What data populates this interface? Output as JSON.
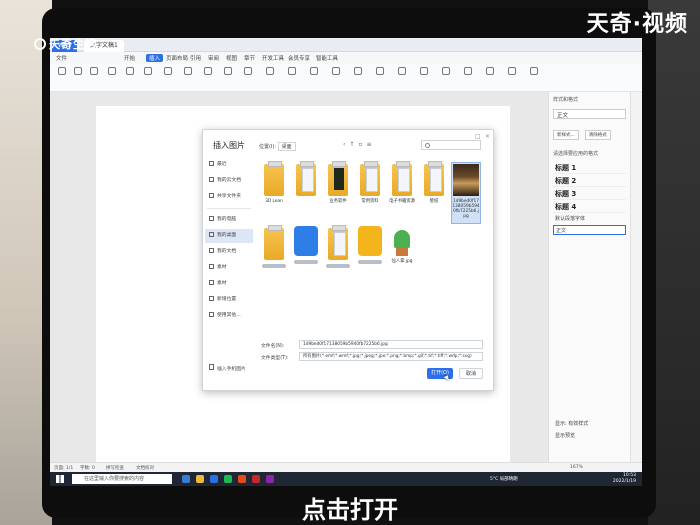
{
  "watermark": {
    "left": "天奇生活",
    "right": "天奇·视频"
  },
  "subtitle": "点击打开",
  "window": {
    "tabs": [
      "WPS",
      "文字文稿1"
    ],
    "menu": [
      "文件",
      "开始",
      "插入",
      "页面布局",
      "引用",
      "审阅",
      "视图",
      "章节",
      "开发工具",
      "会员专享",
      "智能工具"
    ],
    "active_menu": "插入"
  },
  "right_panel": {
    "title": "样式和格式",
    "current_style": "正文",
    "btn_new": "新样式...",
    "btn_clear": "清除格式",
    "hint": "请选择要应用的格式",
    "styles": [
      "标题 1",
      "标题 2",
      "标题 3",
      "标题 4"
    ],
    "small_items": [
      "默认段落字体",
      "正文"
    ],
    "footer_show": "显示: 有效样式",
    "footer_preview": "显示预览"
  },
  "dialog": {
    "title": "插入图片",
    "location_label": "位置(I):",
    "location_value": "桌面",
    "sidebar": [
      "最近",
      "我的云文档",
      "共享文件夹",
      "我的电脑",
      "我的桌面",
      "我的文档",
      "素材",
      "素材",
      "新增位置",
      "使用其他..."
    ],
    "sidebar_bottom": "插入手机图片",
    "files_row1": [
      {
        "name": "3D Lean",
        "kind": "folder"
      },
      {
        "name": "",
        "kind": "folder-doc"
      },
      {
        "name": "业务软件",
        "kind": "folder-dark"
      },
      {
        "name": "常用资料",
        "kind": "folder-doc"
      },
      {
        "name": "电子书籍资源",
        "kind": "folder-doc"
      },
      {
        "name": "壁纸",
        "kind": "folder-doc"
      },
      {
        "name": "1d9bed0f17138059b5940fb7225b6.jpg",
        "kind": "photo"
      }
    ],
    "files_row2": [
      {
        "name": "",
        "kind": "folder"
      },
      {
        "name": "",
        "kind": "app-blue"
      },
      {
        "name": "",
        "kind": "folder-doc"
      },
      {
        "name": "",
        "kind": "app-yellow"
      },
      {
        "name": "仙人掌.jpg",
        "kind": "cactus"
      }
    ],
    "filename_label": "文件名(N):",
    "filename_value": "1d9bed0f17138059b5940fb7225b6.jpg",
    "filetype_label": "文件类型(T):",
    "filetype_value": "所有图片(*.emf;*.wmf;*.jpg;*.jpeg;*.jpe;*.png;*.bmp;*.gif;*.tif;*.tiff;*.wdp;*.svg)",
    "open_label": "打开(O)",
    "cancel_label": "取消"
  },
  "statusbar": {
    "page": "页面: 1/1",
    "words": "字数: 0",
    "spell": "拼写检查",
    "doc": "文档校对",
    "zoom": "167%"
  },
  "taskbar": {
    "search_placeholder": "在这里输入你要搜索的内容",
    "weather": "5°C 局部晴朗",
    "time": "10:53",
    "date": "2022/1/19"
  },
  "colors": {
    "accent": "#2d6fe6",
    "folder": "#f0b83c"
  }
}
